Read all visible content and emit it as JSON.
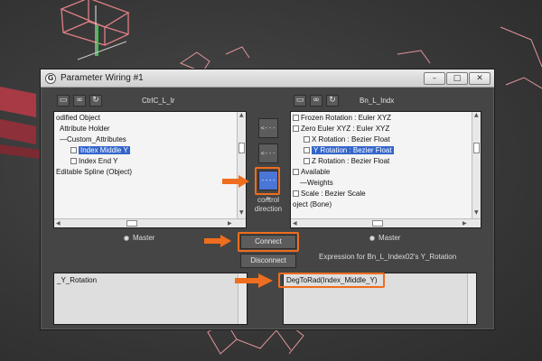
{
  "window": {
    "title": "Parameter Wiring #1",
    "app_icon": "G",
    "minimize_glyph": "–",
    "maximize_glyph": "□",
    "close_glyph": "✕"
  },
  "left_panel": {
    "node_name": "CtrlC_L_Ir",
    "tool_icons": [
      "folder-icon",
      "binoculars-icon",
      "refresh-icon"
    ],
    "tree_items": [
      {
        "text": "odified Object",
        "checkbox": false,
        "selected": false
      },
      {
        "text": "Attribute Holder",
        "checkbox": false,
        "selected": false
      },
      {
        "text": "—Custom_Attributes",
        "checkbox": false,
        "selected": false
      },
      {
        "text": "Index Middle Y",
        "checkbox": true,
        "selected": true
      },
      {
        "text": "Index End Y",
        "checkbox": true,
        "selected": false
      },
      {
        "text": "Editable Spline (Object)",
        "checkbox": false,
        "selected": false
      }
    ],
    "master_label": "Master"
  },
  "right_panel": {
    "node_name": "Bn_L_Indx",
    "tool_icons": [
      "folder-icon",
      "binoculars-icon",
      "refresh-icon"
    ],
    "tree_items": [
      {
        "text": "Frozen Rotation : Euler XYZ",
        "checkbox": true,
        "selected": false
      },
      {
        "text": "Zero Euler XYZ : Euler XYZ",
        "checkbox": true,
        "selected": false
      },
      {
        "text": "X Rotation : Bezier Float",
        "checkbox": true,
        "selected": false
      },
      {
        "text": "Y Rotation : Bezier Float",
        "checkbox": true,
        "selected": true
      },
      {
        "text": "Z Rotation : Bezier Float",
        "checkbox": true,
        "selected": false
      },
      {
        "text": "Available",
        "checkbox": true,
        "selected": false
      },
      {
        "text": "—Weights",
        "checkbox": false,
        "selected": false
      },
      {
        "text": "Scale : Bezier Scale",
        "checkbox": true,
        "selected": false
      },
      {
        "text": "oject (Bone)",
        "checkbox": false,
        "selected": false
      }
    ],
    "master_label": "Master"
  },
  "direction_buttons": [
    {
      "label": "<--->",
      "active": false
    },
    {
      "label": "<----",
      "active": false
    },
    {
      "label": "---->",
      "active": true
    }
  ],
  "control_direction_label": [
    "control",
    "direction"
  ],
  "connect_label": "Connect",
  "disconnect_label": "Disconnect",
  "expression_label": "Expression for Bn_L_Index02's Y_Rotation",
  "left_expression": "_Y_Rotation",
  "right_expression": "DegToRad(Index_Middle_Y)",
  "colors": {
    "highlight": "#ee6d1e",
    "selection": "#3366cc",
    "dialog_bg": "#454545"
  }
}
